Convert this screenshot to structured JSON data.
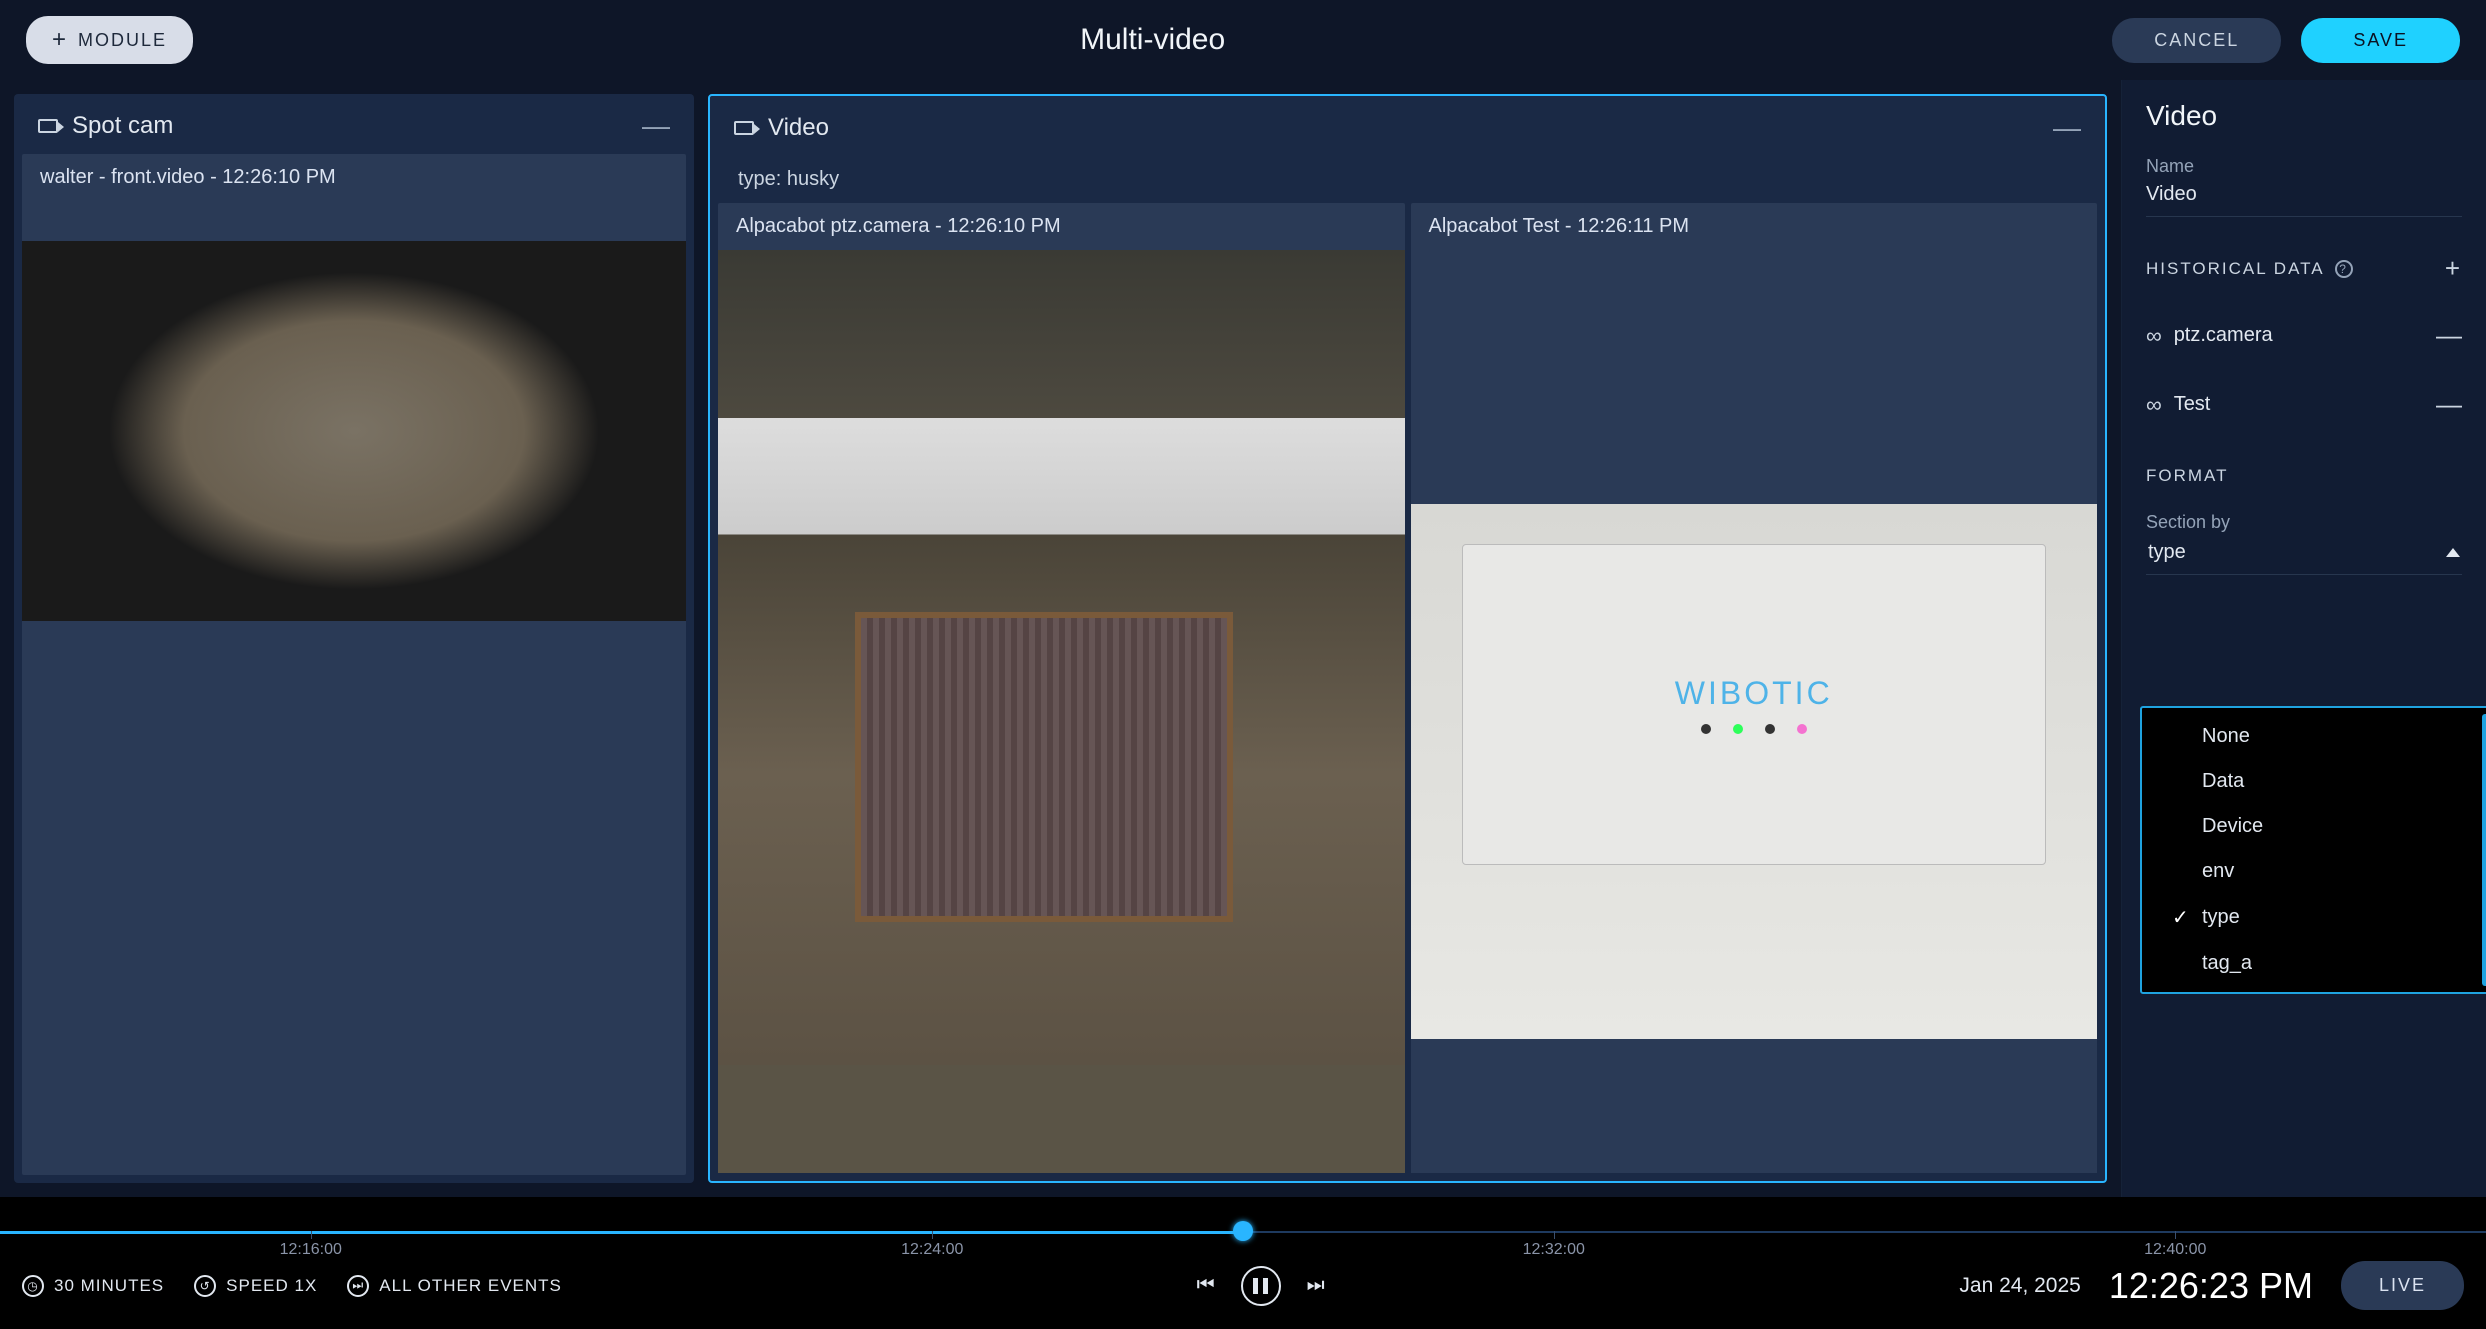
{
  "header": {
    "module_btn": "MODULE",
    "title": "Multi-video",
    "cancel": "CANCEL",
    "save": "SAVE"
  },
  "panels": {
    "spot": {
      "title": "Spot cam",
      "feed_label": "walter - front.video - 12:26:10 PM"
    },
    "video": {
      "title": "Video",
      "type_label": "type: husky",
      "feed1_label": "Alpacabot ptz.camera - 12:26:10 PM",
      "feed2_label": "Alpacabot Test - 12:26:11 PM",
      "wibotic": "WIBOTIC"
    }
  },
  "sidebar": {
    "title": "Video",
    "name_label": "Name",
    "name_value": "Video",
    "historical_header": "HISTORICAL DATA",
    "hd_items": [
      "ptz.camera",
      "Test"
    ],
    "format_header": "FORMAT",
    "section_by_label": "Section by",
    "section_by_value": "type",
    "dropdown_options": [
      "None",
      "Data",
      "Device",
      "env",
      "type",
      "tag_a"
    ],
    "dropdown_selected": "type"
  },
  "timeline": {
    "ticks": [
      "12:16:00",
      "12:24:00",
      "12:32:00",
      "12:40:00"
    ],
    "progress_pct": 50,
    "range_label": "30 MINUTES",
    "speed_label": "SPEED 1X",
    "events_label": "ALL OTHER EVENTS",
    "date": "Jan 24, 2025",
    "time": "12:26:23 PM",
    "live": "LIVE"
  }
}
